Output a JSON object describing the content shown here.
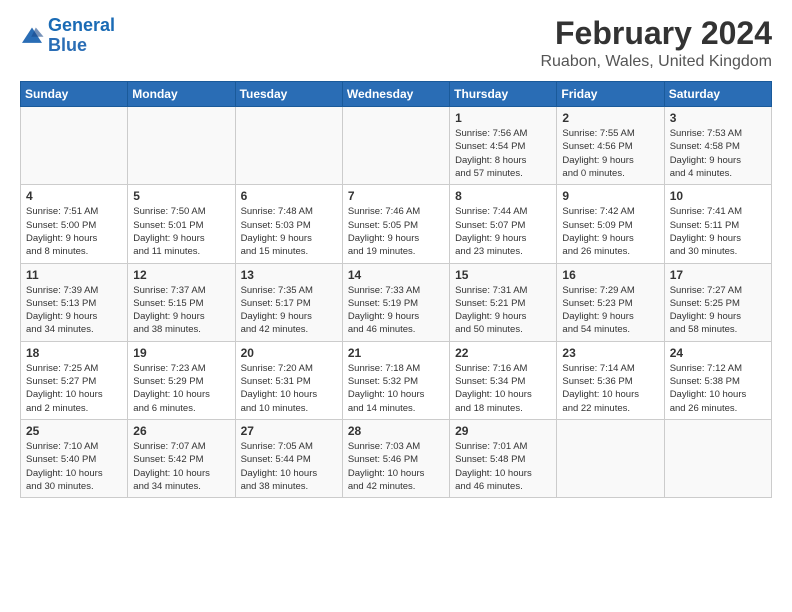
{
  "header": {
    "logo_line1": "General",
    "logo_line2": "Blue",
    "month_title": "February 2024",
    "location": "Ruabon, Wales, United Kingdom"
  },
  "days_of_week": [
    "Sunday",
    "Monday",
    "Tuesday",
    "Wednesday",
    "Thursday",
    "Friday",
    "Saturday"
  ],
  "weeks": [
    [
      {
        "day": "",
        "info": ""
      },
      {
        "day": "",
        "info": ""
      },
      {
        "day": "",
        "info": ""
      },
      {
        "day": "",
        "info": ""
      },
      {
        "day": "1",
        "info": "Sunrise: 7:56 AM\nSunset: 4:54 PM\nDaylight: 8 hours\nand 57 minutes."
      },
      {
        "day": "2",
        "info": "Sunrise: 7:55 AM\nSunset: 4:56 PM\nDaylight: 9 hours\nand 0 minutes."
      },
      {
        "day": "3",
        "info": "Sunrise: 7:53 AM\nSunset: 4:58 PM\nDaylight: 9 hours\nand 4 minutes."
      }
    ],
    [
      {
        "day": "4",
        "info": "Sunrise: 7:51 AM\nSunset: 5:00 PM\nDaylight: 9 hours\nand 8 minutes."
      },
      {
        "day": "5",
        "info": "Sunrise: 7:50 AM\nSunset: 5:01 PM\nDaylight: 9 hours\nand 11 minutes."
      },
      {
        "day": "6",
        "info": "Sunrise: 7:48 AM\nSunset: 5:03 PM\nDaylight: 9 hours\nand 15 minutes."
      },
      {
        "day": "7",
        "info": "Sunrise: 7:46 AM\nSunset: 5:05 PM\nDaylight: 9 hours\nand 19 minutes."
      },
      {
        "day": "8",
        "info": "Sunrise: 7:44 AM\nSunset: 5:07 PM\nDaylight: 9 hours\nand 23 minutes."
      },
      {
        "day": "9",
        "info": "Sunrise: 7:42 AM\nSunset: 5:09 PM\nDaylight: 9 hours\nand 26 minutes."
      },
      {
        "day": "10",
        "info": "Sunrise: 7:41 AM\nSunset: 5:11 PM\nDaylight: 9 hours\nand 30 minutes."
      }
    ],
    [
      {
        "day": "11",
        "info": "Sunrise: 7:39 AM\nSunset: 5:13 PM\nDaylight: 9 hours\nand 34 minutes."
      },
      {
        "day": "12",
        "info": "Sunrise: 7:37 AM\nSunset: 5:15 PM\nDaylight: 9 hours\nand 38 minutes."
      },
      {
        "day": "13",
        "info": "Sunrise: 7:35 AM\nSunset: 5:17 PM\nDaylight: 9 hours\nand 42 minutes."
      },
      {
        "day": "14",
        "info": "Sunrise: 7:33 AM\nSunset: 5:19 PM\nDaylight: 9 hours\nand 46 minutes."
      },
      {
        "day": "15",
        "info": "Sunrise: 7:31 AM\nSunset: 5:21 PM\nDaylight: 9 hours\nand 50 minutes."
      },
      {
        "day": "16",
        "info": "Sunrise: 7:29 AM\nSunset: 5:23 PM\nDaylight: 9 hours\nand 54 minutes."
      },
      {
        "day": "17",
        "info": "Sunrise: 7:27 AM\nSunset: 5:25 PM\nDaylight: 9 hours\nand 58 minutes."
      }
    ],
    [
      {
        "day": "18",
        "info": "Sunrise: 7:25 AM\nSunset: 5:27 PM\nDaylight: 10 hours\nand 2 minutes."
      },
      {
        "day": "19",
        "info": "Sunrise: 7:23 AM\nSunset: 5:29 PM\nDaylight: 10 hours\nand 6 minutes."
      },
      {
        "day": "20",
        "info": "Sunrise: 7:20 AM\nSunset: 5:31 PM\nDaylight: 10 hours\nand 10 minutes."
      },
      {
        "day": "21",
        "info": "Sunrise: 7:18 AM\nSunset: 5:32 PM\nDaylight: 10 hours\nand 14 minutes."
      },
      {
        "day": "22",
        "info": "Sunrise: 7:16 AM\nSunset: 5:34 PM\nDaylight: 10 hours\nand 18 minutes."
      },
      {
        "day": "23",
        "info": "Sunrise: 7:14 AM\nSunset: 5:36 PM\nDaylight: 10 hours\nand 22 minutes."
      },
      {
        "day": "24",
        "info": "Sunrise: 7:12 AM\nSunset: 5:38 PM\nDaylight: 10 hours\nand 26 minutes."
      }
    ],
    [
      {
        "day": "25",
        "info": "Sunrise: 7:10 AM\nSunset: 5:40 PM\nDaylight: 10 hours\nand 30 minutes."
      },
      {
        "day": "26",
        "info": "Sunrise: 7:07 AM\nSunset: 5:42 PM\nDaylight: 10 hours\nand 34 minutes."
      },
      {
        "day": "27",
        "info": "Sunrise: 7:05 AM\nSunset: 5:44 PM\nDaylight: 10 hours\nand 38 minutes."
      },
      {
        "day": "28",
        "info": "Sunrise: 7:03 AM\nSunset: 5:46 PM\nDaylight: 10 hours\nand 42 minutes."
      },
      {
        "day": "29",
        "info": "Sunrise: 7:01 AM\nSunset: 5:48 PM\nDaylight: 10 hours\nand 46 minutes."
      },
      {
        "day": "",
        "info": ""
      },
      {
        "day": "",
        "info": ""
      }
    ]
  ]
}
